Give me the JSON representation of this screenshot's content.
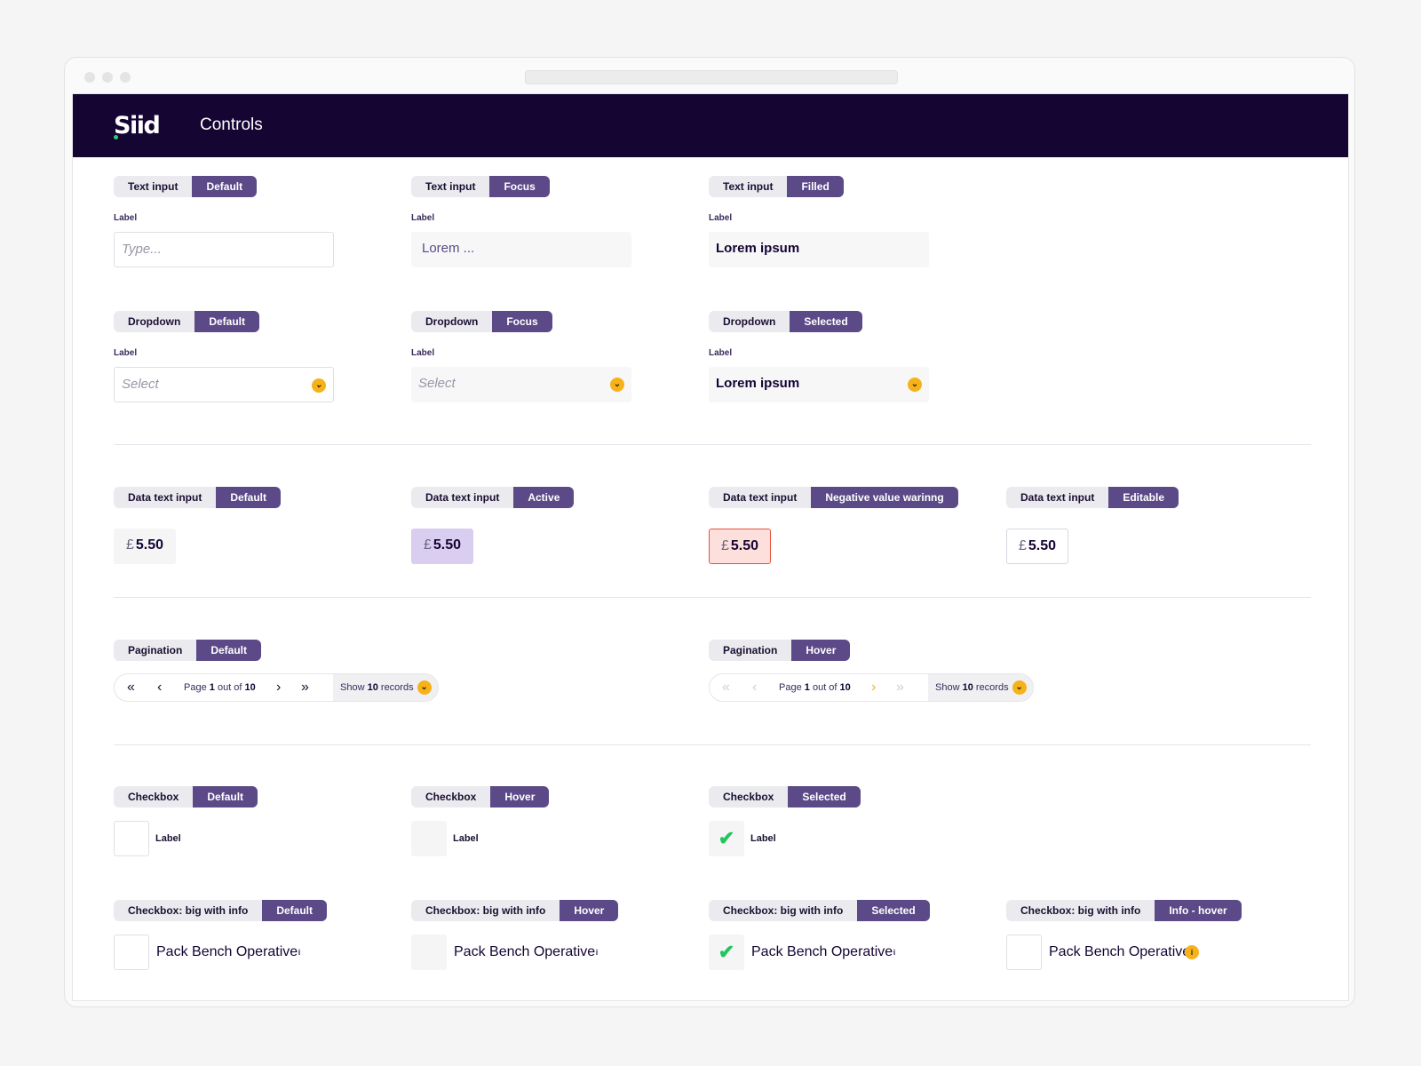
{
  "app": {
    "logo": "Siid",
    "title": "Controls"
  },
  "text_inputs": [
    {
      "tag1": "Text input",
      "tag2": "Default",
      "label": "Label",
      "placeholder": "Type..."
    },
    {
      "tag1": "Text input",
      "tag2": "Focus",
      "label": "Label",
      "value": "Lorem ..."
    },
    {
      "tag1": "Text input",
      "tag2": "Filled",
      "label": "Label",
      "value": "Lorem ipsum"
    }
  ],
  "dropdowns": [
    {
      "tag1": "Dropdown",
      "tag2": "Default",
      "label": "Label",
      "value": "Select"
    },
    {
      "tag1": "Dropdown",
      "tag2": "Focus",
      "label": "Label",
      "value": "Select"
    },
    {
      "tag1": "Dropdown",
      "tag2": "Selected",
      "label": "Label",
      "value": "Lorem ipsum"
    }
  ],
  "data_inputs": [
    {
      "tag1": "Data text input",
      "tag2": "Default",
      "currency": "£",
      "value": "5.50"
    },
    {
      "tag1": "Data text input",
      "tag2": "Active",
      "currency": "£",
      "value": "5.50"
    },
    {
      "tag1": "Data text input",
      "tag2": "Negative value warinng",
      "currency": "£",
      "value": "5.50"
    },
    {
      "tag1": "Data text input",
      "tag2": "Editable",
      "currency": "£",
      "value": "5.50"
    }
  ],
  "paginations": [
    {
      "tag1": "Pagination",
      "tag2": "Default",
      "page_word": "Page",
      "page": "1",
      "out_of": "out of",
      "total": "10",
      "show": "Show",
      "records_count": "10",
      "records": "records"
    },
    {
      "tag1": "Pagination",
      "tag2": "Hover",
      "page_word": "Page",
      "page": "1",
      "out_of": "out of",
      "total": "10",
      "show": "Show",
      "records_count": "10",
      "records": "records"
    }
  ],
  "checkboxes": [
    {
      "tag1": "Checkbox",
      "tag2": "Default",
      "label": "Label"
    },
    {
      "tag1": "Checkbox",
      "tag2": "Hover",
      "label": "Label"
    },
    {
      "tag1": "Checkbox",
      "tag2": "Selected",
      "label": "Label"
    }
  ],
  "big_checkboxes": [
    {
      "tag1": "Checkbox: big with info",
      "tag2": "Default",
      "label": "Pack Bench Operative"
    },
    {
      "tag1": "Checkbox: big with info",
      "tag2": "Hover",
      "label": "Pack Bench Operative"
    },
    {
      "tag1": "Checkbox: big with info",
      "tag2": "Selected",
      "label": "Pack Bench Operative"
    },
    {
      "tag1": "Checkbox: big with info",
      "tag2": "Info - hover",
      "label": "Pack Bench Operative"
    }
  ],
  "icons": {
    "check": "checkmark-icon",
    "info": "info-icon",
    "chevron": "chevron-down-icon",
    "first": "double-chevron-left-icon",
    "prev": "chevron-left-icon",
    "next": "chevron-right-icon",
    "last": "double-chevron-right-icon"
  },
  "colors": {
    "brand": "#140533",
    "accent": "#5b4a87",
    "highlight": "#f6b21b",
    "success": "#22c55e",
    "danger": "#e8533d"
  }
}
